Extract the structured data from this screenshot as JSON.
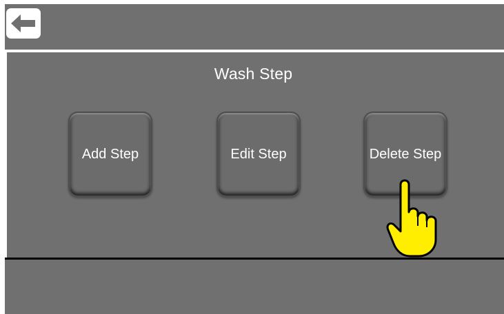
{
  "header": {
    "back_icon": "left-arrow-icon"
  },
  "main": {
    "title": "Wash Step",
    "buttons": [
      {
        "label": "Add Step"
      },
      {
        "label": "Edit Step"
      },
      {
        "label": "Delete Step"
      }
    ]
  },
  "overlay": {
    "pointer_icon": "pointing-hand-icon",
    "pointer_color": "#ffec00"
  },
  "colors": {
    "background": "#707070",
    "text": "#ffffff",
    "divider_top": "#ffffff",
    "divider_bottom": "#000000"
  }
}
